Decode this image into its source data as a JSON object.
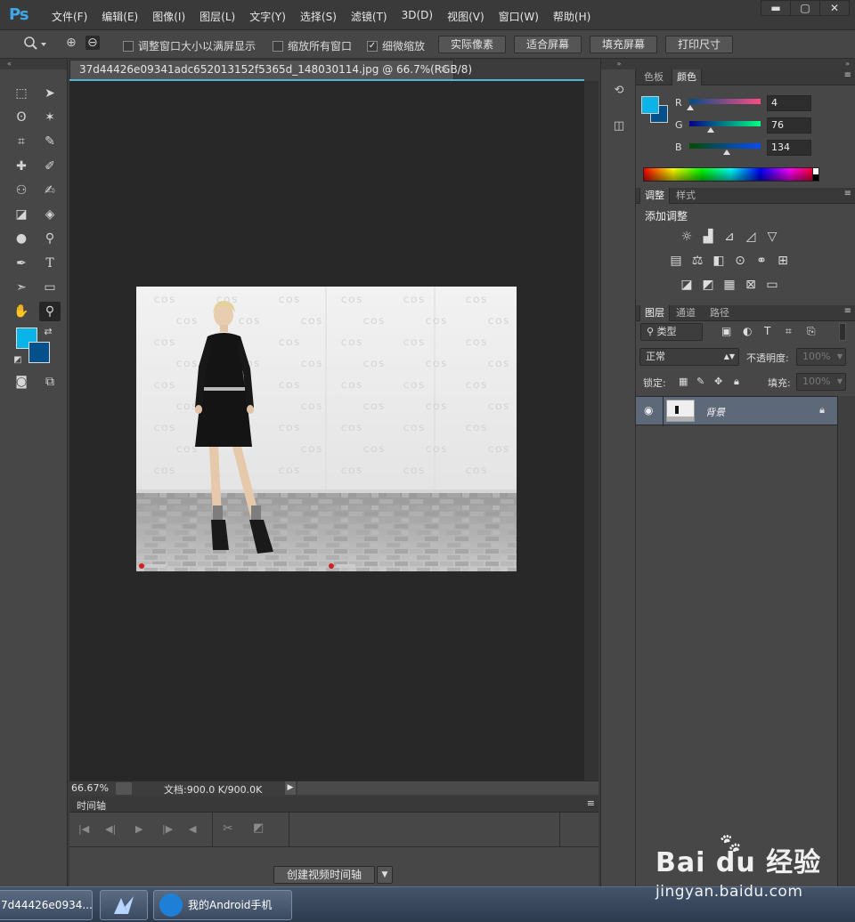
{
  "app": {
    "logo": "Ps",
    "menu": [
      "文件(F)",
      "编辑(E)",
      "图像(I)",
      "图层(L)",
      "文字(Y)",
      "选择(S)",
      "滤镜(T)",
      "3D(D)",
      "视图(V)",
      "窗口(W)",
      "帮助(H)"
    ],
    "window_controls": [
      "▬",
      "▢",
      "✕"
    ]
  },
  "options_bar": {
    "tool_icon": "zoom-icon",
    "zoom_in_symbol": "⊕",
    "zoom_out_symbol": "⊖",
    "checks": [
      {
        "label": "调整窗口大小以满屏显示",
        "checked": false
      },
      {
        "label": "缩放所有窗口",
        "checked": false
      },
      {
        "label": "细微缩放",
        "checked": true
      }
    ],
    "buttons": [
      "实际像素",
      "适合屏幕",
      "填充屏幕",
      "打印尺寸"
    ]
  },
  "document": {
    "tab_title": "37d44426e09341adc652013152f5365d_148030114.jpg @ 66.7%(RGB/8)",
    "tab_close": "×",
    "zoom": "66.67%",
    "doc_info": "文档:900.0 K/900.0K"
  },
  "timeline": {
    "title": "时间轴",
    "create_button": "创建视频时间轴"
  },
  "colors": {
    "foreground": "#0ab4e8",
    "background": "#03508a"
  },
  "color_panel": {
    "tabs": [
      "色板",
      "颜色"
    ],
    "channels": [
      {
        "label": "R",
        "value": "4",
        "level": 0.016
      },
      {
        "label": "G",
        "value": "76",
        "level": 0.298
      },
      {
        "label": "B",
        "value": "134",
        "level": 0.525
      }
    ]
  },
  "adjustments_panel": {
    "tabs": [
      "调整",
      "样式"
    ],
    "title": "添加调整"
  },
  "layers_panel": {
    "tabs": [
      "图层",
      "通道",
      "路径"
    ],
    "filter_label": "类型",
    "blend_mode": "正常",
    "opacity_label": "不透明度:",
    "opacity_value": "100%",
    "lock_label": "锁定:",
    "fill_label": "填充:",
    "fill_value": "100%",
    "layers": [
      {
        "name": "背景",
        "locked": true,
        "visible": true
      }
    ]
  },
  "taskbar": {
    "items": [
      "7d44426e0934...",
      "",
      "我的Android手机"
    ]
  },
  "watermark": {
    "main": "Bai du 经验",
    "sub": "jingyan.baidu.com"
  },
  "photo": {
    "backdrop_text": "COS"
  }
}
